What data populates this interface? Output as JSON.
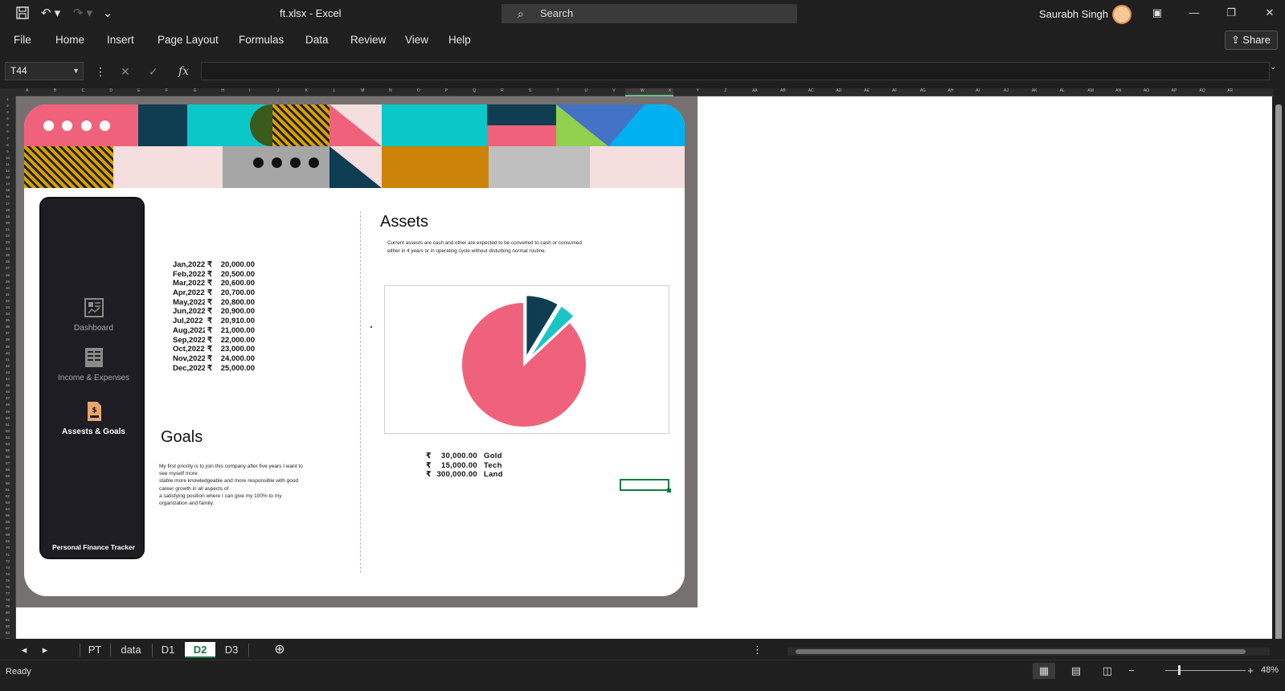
{
  "window": {
    "title": "ft.xlsx  -  Excel",
    "search_placeholder": "Search",
    "user_name": "Saurabh Singh"
  },
  "menu": [
    "File",
    "Home",
    "Insert",
    "Page Layout",
    "Formulas",
    "Data",
    "Review",
    "View",
    "Help"
  ],
  "share_label": "Share",
  "formula_bar": {
    "name_box": "T44",
    "fx_label": "fx",
    "formula": ""
  },
  "columns": [
    "A",
    "B",
    "C",
    "D",
    "E",
    "F",
    "G",
    "H",
    "I",
    "J",
    "K",
    "L",
    "M",
    "N",
    "O",
    "P",
    "Q",
    "R",
    "S",
    "T",
    "U",
    "V",
    "W",
    "X",
    "Y",
    "Z",
    "AA",
    "AB",
    "AC",
    "AD",
    "AE",
    "AF",
    "AG",
    "AH",
    "AI",
    "AJ",
    "AK",
    "AL",
    "AM",
    "AN",
    "AO",
    "AP",
    "AQ",
    "AR"
  ],
  "selected_column": "T",
  "sidebar": {
    "items": [
      {
        "label": "Dashboard",
        "icon": "dashboard-icon"
      },
      {
        "label": "Income & Expenses",
        "icon": "ledger-icon"
      },
      {
        "label": "Assests & Goals",
        "icon": "money-document-icon"
      }
    ],
    "footer": "Personal Finance Tracker"
  },
  "monthly": {
    "currency": "₹",
    "rows": [
      {
        "month": "Jan,2022",
        "amount": "20,000.00"
      },
      {
        "month": "Feb,2022",
        "amount": "20,500.00"
      },
      {
        "month": "Mar,2022",
        "amount": "20,600.00"
      },
      {
        "month": "Apr,2022",
        "amount": "20,700.00"
      },
      {
        "month": "May,2022",
        "amount": "20,800.00"
      },
      {
        "month": "Jun,2022",
        "amount": "20,900.00"
      },
      {
        "month": "Jul,2022",
        "amount": "20,910.00"
      },
      {
        "month": "Aug,2022",
        "amount": "21,000.00"
      },
      {
        "month": "Sep,2022",
        "amount": "22,000.00"
      },
      {
        "month": "Oct,2022",
        "amount": "23,000.00"
      },
      {
        "month": "Nov,2022",
        "amount": "24,000.00"
      },
      {
        "month": "Dec,2022",
        "amount": "25,000.00"
      }
    ]
  },
  "goals": {
    "heading": "Goals",
    "lines": [
      "My first priority is to join this company after five years I want to",
      "see myself more",
      "stable more knowledgeable and more responsible with good",
      "career growth in all aspects of",
      "a satisfying position where I can give my 100% to my",
      "organization and family."
    ]
  },
  "assets": {
    "heading": "Assets",
    "desc_lines": [
      "Current assests are cash and other are expected to be converted to cash or consumed",
      "either in 4 years or in operating cycle without disturbing normal routine."
    ],
    "currency": "₹",
    "rows": [
      {
        "amount": "30,000.00",
        "name": "Gold"
      },
      {
        "amount": "15,000.00",
        "name": "Tech"
      },
      {
        "amount": "300,000.00",
        "name": "Land"
      }
    ]
  },
  "chart_data": {
    "type": "pie",
    "categories": [
      "Gold",
      "Tech",
      "Land"
    ],
    "values": [
      30000,
      15000,
      300000
    ],
    "colors": [
      "#0f3d52",
      "#1cc5c5",
      "#f0627c"
    ],
    "exploded": true
  },
  "sheets": {
    "tabs": [
      "PT",
      "data",
      "D1",
      "D2",
      "D3"
    ],
    "active": "D2"
  },
  "status": {
    "ready": "Ready",
    "zoom": "48%"
  },
  "colors": {
    "pink": "#f0627c",
    "navy": "#0f3d52",
    "teal": "#0ac8c8",
    "olive": "#3b5a1e",
    "lightpink": "#f4dede",
    "gray": "#a6a6a6",
    "orange": "#cc8408",
    "lightgray": "#bfbfbf",
    "green": "#92d050",
    "blue": "#4472c4",
    "skyblue": "#00b0f0"
  }
}
